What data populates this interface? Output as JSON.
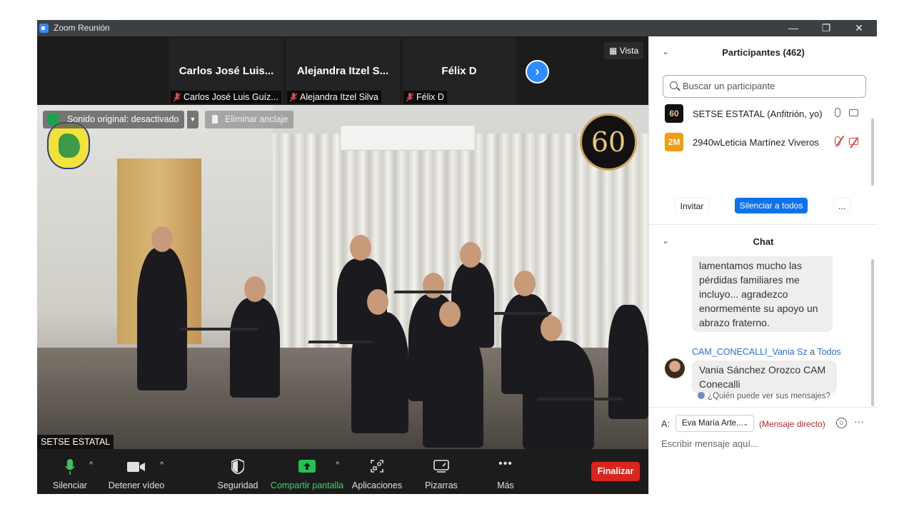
{
  "window": {
    "title": "Zoom Reunión",
    "min_glyph": "—",
    "restore_glyph": "❐",
    "close_glyph": "✕"
  },
  "gallery": {
    "tiles": [
      {
        "display": "Carlos José Luis...",
        "label": "Carlos José Luis Guíz..."
      },
      {
        "display": "Alejandra Itzel S...",
        "label": "Alejandra Itzel Silva"
      },
      {
        "display": "Félix D",
        "label": "Félix D"
      }
    ],
    "next_glyph": "›",
    "view_label": "Vista"
  },
  "video": {
    "sound_status": "Sonido original: desactivado",
    "unpin_label": "Eliminar anclaje",
    "speaker_name": "SETSE ESTATAL",
    "logo_60_text": "60"
  },
  "toolbar": {
    "mute": "Silenciar",
    "stop_video": "Detener vídeo",
    "security": "Seguridad",
    "share_screen": "Compartir pantalla",
    "apps": "Aplicaciones",
    "whiteboards": "Pizarras",
    "more": "Más",
    "more_glyph": "•••",
    "end": "Finalizar",
    "caret": "^"
  },
  "participants": {
    "header": "Participantes (462)",
    "collapse_glyph": "⌄",
    "search_placeholder": "Buscar un participante",
    "list": [
      {
        "avatar": "60",
        "avatar_color": "#111111",
        "name": "SETSE ESTATAL (Anfitrión, yo)",
        "mic_off": false,
        "cam_off": false
      },
      {
        "avatar": "2M",
        "avatar_color": "#f39c12",
        "name": "2940wLeticia Martínez Viveros",
        "mic_off": true,
        "cam_off": true
      }
    ],
    "invite": "Invitar",
    "mute_all": "Silenciar a todos",
    "more": "..."
  },
  "chat": {
    "header": "Chat",
    "message1": "lamentamos mucho las pérdidas familiares me incluyo... agradezco enormemente su apoyo un abrazo fraterno.",
    "message2_sender": "CAM_CONECALLI_Vania Sz",
    "message2_to_word": " a ",
    "message2_to": "Todos",
    "message2": "Vania Sánchez Orozco CAM Conecalli",
    "who_can_see": "¿Quién puede ver sus mensajes?",
    "to_label": "A:",
    "recipient": "Eva María Arte...",
    "recipient_caret": "⌄",
    "direct": "(Mensaje directo)",
    "emoji_glyph": "☺",
    "more_glyph": "···",
    "input_placeholder": "Escribir mensaje aquí..."
  }
}
